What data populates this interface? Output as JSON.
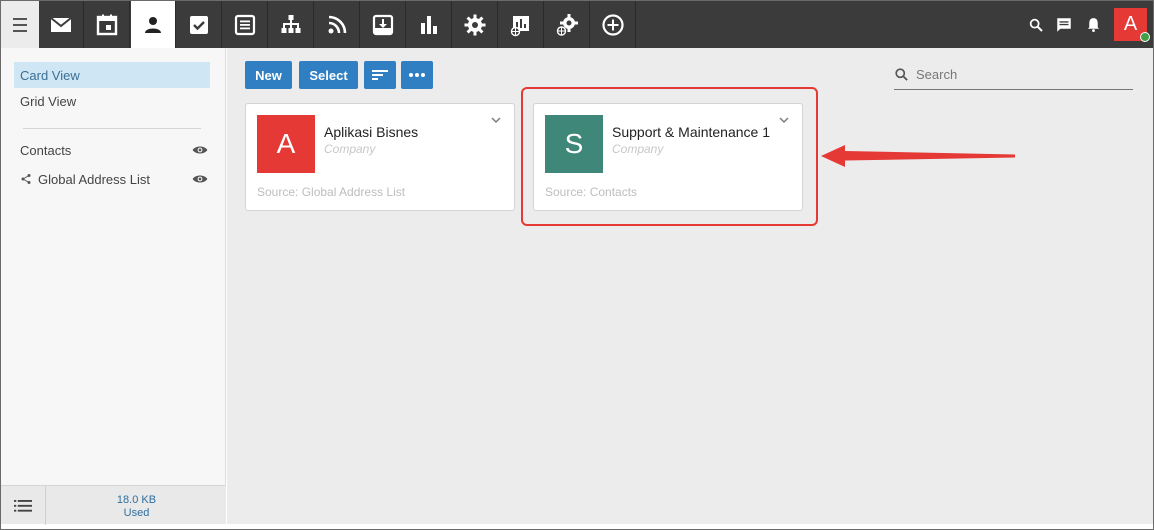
{
  "topbar": {
    "apps": [
      {
        "icon": "mail-icon",
        "active": false
      },
      {
        "icon": "calendar-icon",
        "active": false
      },
      {
        "icon": "contacts-icon",
        "active": true
      },
      {
        "icon": "tasks-icon",
        "active": false
      },
      {
        "icon": "notes-icon",
        "active": false
      },
      {
        "icon": "org-chart-icon",
        "active": false
      },
      {
        "icon": "rss-icon",
        "active": false
      },
      {
        "icon": "download-box-icon",
        "active": false
      },
      {
        "icon": "bar-chart-icon",
        "active": false
      },
      {
        "icon": "settings-icon",
        "active": false
      },
      {
        "icon": "report-globe-icon",
        "active": false
      },
      {
        "icon": "globe-settings-icon",
        "active": false
      },
      {
        "icon": "add-circle-icon",
        "active": false
      }
    ],
    "avatar_letter": "A",
    "avatar_color": "#e53935",
    "status_color": "#43a047"
  },
  "sidebar": {
    "views": [
      {
        "label": "Card View",
        "selected": true
      },
      {
        "label": "Grid View",
        "selected": false
      }
    ],
    "sources": [
      {
        "label": "Contacts",
        "shared": false
      },
      {
        "label": "Global Address List",
        "shared": true
      }
    ],
    "storage": {
      "amount": "18.0 KB",
      "label": "Used"
    }
  },
  "toolbar": {
    "new_label": "New",
    "select_label": "Select",
    "accent_color": "#2f7fc2"
  },
  "search": {
    "placeholder": "Search"
  },
  "cards": [
    {
      "initial": "A",
      "color": "#e53935",
      "name": "Aplikasi Bisnes",
      "type": "Company",
      "source": "Source: Global Address List"
    },
    {
      "initial": "S",
      "color": "#3f8879",
      "name": "Support & Maintenance 1",
      "type": "Company",
      "source": "Source: Contacts"
    }
  ],
  "annotation": {
    "color": "#e53935"
  }
}
